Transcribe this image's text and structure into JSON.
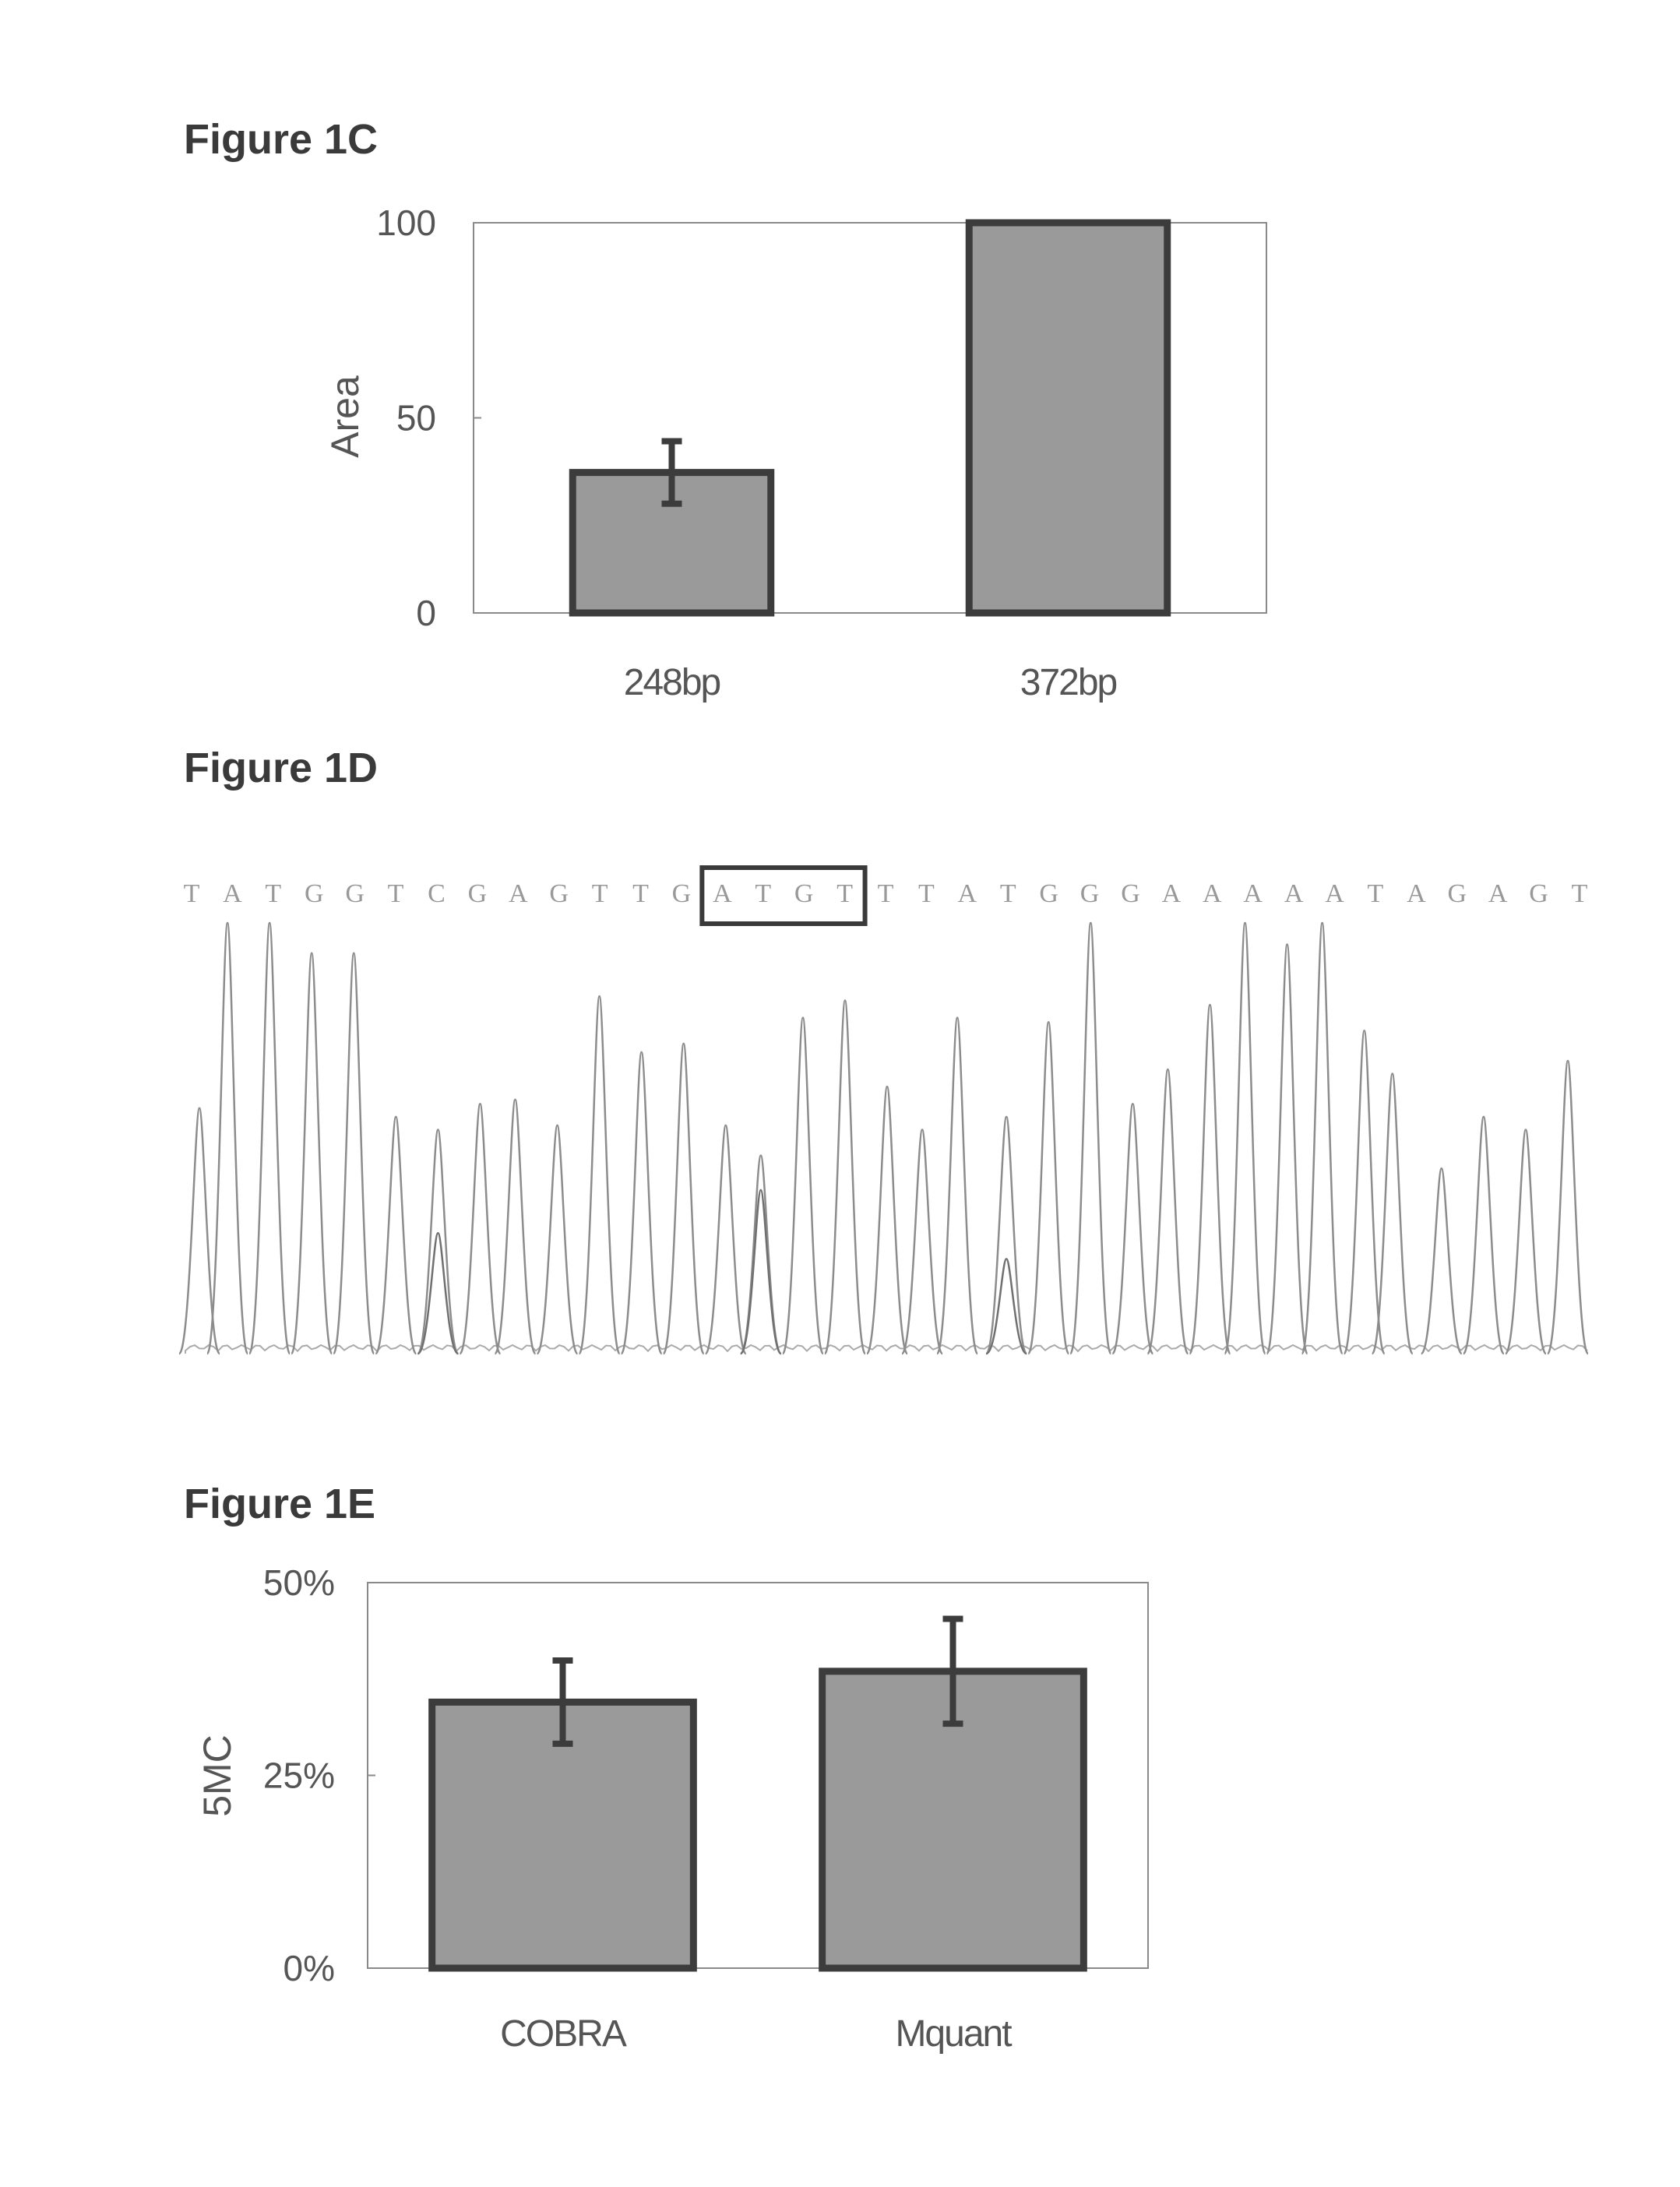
{
  "chart_data": [
    {
      "id": "1C",
      "type": "bar",
      "title": "Figure 1C",
      "xlabel": "",
      "ylabel": "Area",
      "ylim": [
        0,
        100
      ],
      "yticks": [
        "0",
        "50",
        "100"
      ],
      "ytick_values": [
        0,
        50,
        100
      ],
      "categories": [
        "248bp",
        "372bp"
      ],
      "values": [
        36,
        100
      ],
      "errors": [
        8,
        null
      ],
      "grid": false,
      "bar_fill": "#9a9a9a",
      "bar_edge": "#3c3c3c"
    },
    {
      "id": "1D",
      "type": "line",
      "title": "Figure 1D",
      "subtype": "sequencing-chromatogram",
      "sequence": [
        "T",
        "A",
        "T",
        "G",
        "G",
        "T",
        "C",
        "G",
        "A",
        "G",
        "T",
        "T",
        "G",
        "A",
        "T",
        "G",
        "T",
        "T",
        "T",
        "A",
        "T",
        "G",
        "G",
        "G",
        "A",
        "A",
        "A",
        "A",
        "A",
        "T",
        "A",
        "G",
        "A",
        "G",
        "T"
      ],
      "highlighted_bases": {
        "start_index": 13,
        "end_index": 16,
        "text": "ATGT"
      },
      "peaks": {
        "position": [
          0.01,
          0.03,
          0.06,
          0.09,
          0.12,
          0.15,
          0.18,
          0.21,
          0.235,
          0.265,
          0.295,
          0.325,
          0.355,
          0.385,
          0.41,
          0.44,
          0.47,
          0.5,
          0.525,
          0.55,
          0.585,
          0.615,
          0.645,
          0.675,
          0.7,
          0.73,
          0.755,
          0.785,
          0.81,
          0.84,
          0.86,
          0.895,
          0.925,
          0.955,
          0.985
        ],
        "height": [
          0.57,
          1.0,
          1.0,
          0.93,
          0.93,
          0.55,
          0.52,
          0.58,
          0.59,
          0.53,
          0.83,
          0.7,
          0.72,
          0.53,
          0.46,
          0.78,
          0.82,
          0.62,
          0.52,
          0.78,
          0.55,
          0.77,
          1.0,
          0.58,
          0.66,
          0.81,
          1.0,
          0.95,
          1.0,
          0.75,
          0.65,
          0.43,
          0.55,
          0.52,
          0.68
        ]
      },
      "minor_peaks": {
        "position": [
          0.18,
          0.41,
          0.585
        ],
        "height": [
          0.28,
          0.38,
          0.22
        ]
      }
    },
    {
      "id": "1E",
      "type": "bar",
      "title": "Figure 1E",
      "xlabel": "",
      "ylabel": "5MC",
      "ylim": [
        0,
        50
      ],
      "yticks": [
        "0%",
        "25%",
        "50%"
      ],
      "ytick_values": [
        0,
        25,
        50
      ],
      "categories": [
        "COBRA",
        "Mquant"
      ],
      "values": [
        34.5,
        38.5
      ],
      "errors": [
        5.4,
        6.8
      ],
      "grid": false,
      "bar_fill": "#9a9a9a",
      "bar_edge": "#3c3c3c"
    }
  ]
}
